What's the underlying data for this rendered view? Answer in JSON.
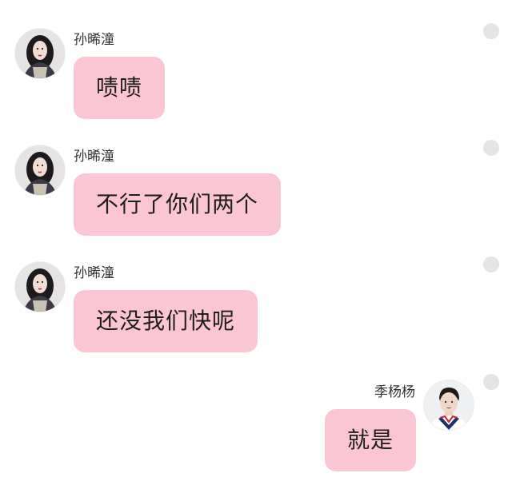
{
  "messages": [
    {
      "side": "left",
      "sender": "孙晞潼",
      "text": "啧啧"
    },
    {
      "side": "left",
      "sender": "孙晞潼",
      "text": "不行了你们两个"
    },
    {
      "side": "left",
      "sender": "孙晞潼",
      "text": "还没我们快呢"
    },
    {
      "side": "right",
      "sender": "季杨杨",
      "text": "就是"
    }
  ],
  "colors": {
    "bubble": "#fbc6d3",
    "status_dot": "#e4e4e4"
  }
}
